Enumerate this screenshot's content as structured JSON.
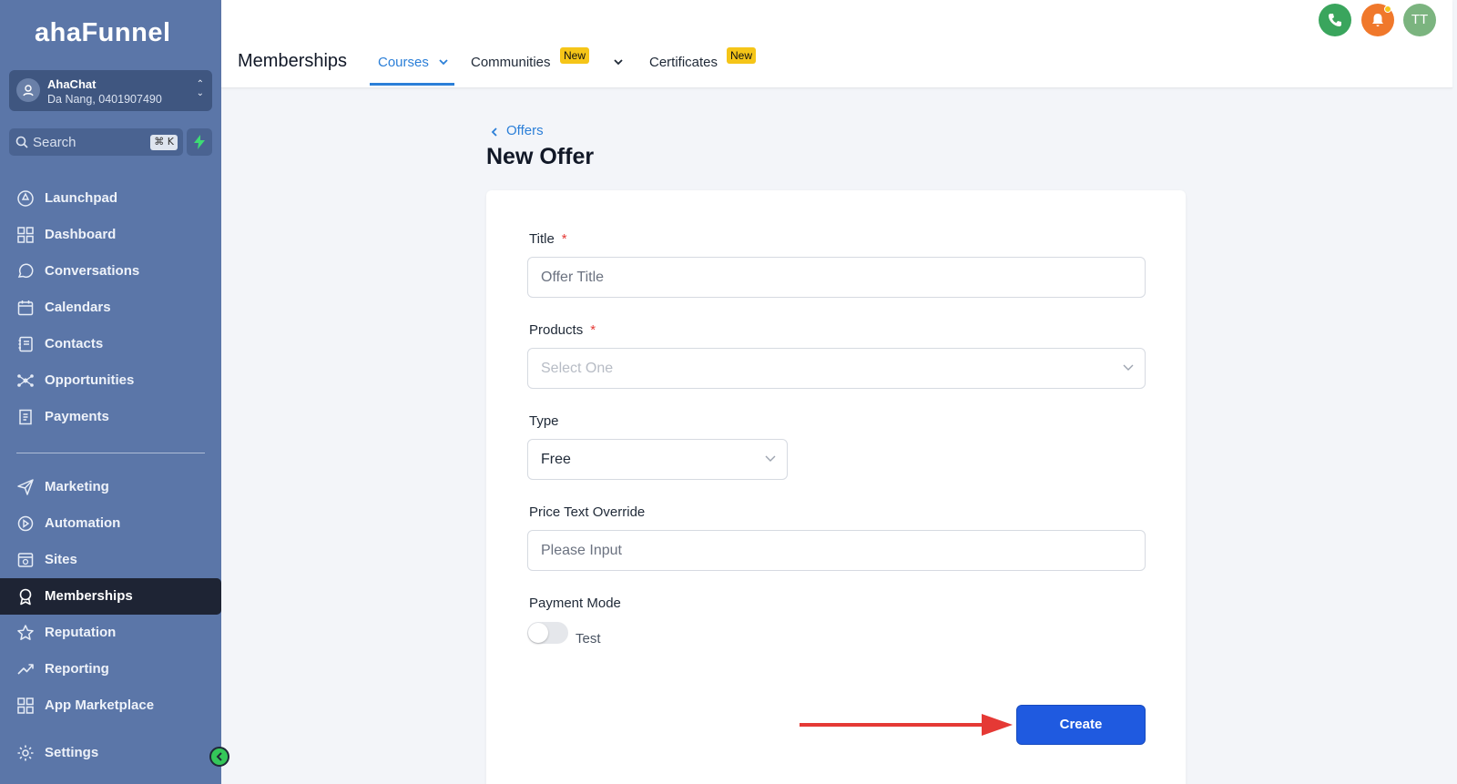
{
  "brand": {
    "logo": "ahaFunnel"
  },
  "account": {
    "name": "AhaChat",
    "location": "Da Nang, 0401907490"
  },
  "search": {
    "placeholder": "Search",
    "shortcut": "⌘ K"
  },
  "sidebar": {
    "items": [
      {
        "label": "Launchpad",
        "icon": "rocket-icon"
      },
      {
        "label": "Dashboard",
        "icon": "grid-icon"
      },
      {
        "label": "Conversations",
        "icon": "chat-icon"
      },
      {
        "label": "Calendars",
        "icon": "calendar-icon"
      },
      {
        "label": "Contacts",
        "icon": "contacts-icon"
      },
      {
        "label": "Opportunities",
        "icon": "network-icon"
      },
      {
        "label": "Payments",
        "icon": "receipt-icon"
      },
      {
        "label": "Marketing",
        "icon": "send-icon"
      },
      {
        "label": "Automation",
        "icon": "automation-icon"
      },
      {
        "label": "Sites",
        "icon": "globe-icon"
      },
      {
        "label": "Memberships",
        "icon": "award-icon",
        "active": true
      },
      {
        "label": "Reputation",
        "icon": "star-icon"
      },
      {
        "label": "Reporting",
        "icon": "trend-icon"
      },
      {
        "label": "App Marketplace",
        "icon": "apps-icon"
      },
      {
        "label": "Settings",
        "icon": "gear-icon"
      }
    ]
  },
  "header": {
    "title": "Memberships",
    "tabs": [
      {
        "label": "Courses",
        "active": true
      },
      {
        "label": "Communities",
        "badge": "New"
      },
      {
        "label": "Certificates",
        "badge": "New"
      }
    ],
    "avatar_initials": "TT"
  },
  "page": {
    "breadcrumb": "Offers",
    "heading": "New Offer"
  },
  "form": {
    "title": {
      "label": "Title",
      "placeholder": "Offer Title"
    },
    "products": {
      "label": "Products",
      "placeholder": "Select One"
    },
    "type": {
      "label": "Type",
      "value": "Free"
    },
    "price_text": {
      "label": "Price Text Override",
      "placeholder": "Please Input"
    },
    "payment_mode": {
      "label": "Payment Mode",
      "toggle_label": "Test",
      "enabled": false
    },
    "required_marker": "*",
    "submit_label": "Create"
  },
  "colors": {
    "sidebar_bg": "#5b76a8",
    "accent_blue": "#2b7fd8",
    "primary_button": "#1f5ae0",
    "badge_yellow": "#f5c518",
    "annotation_arrow": "#e53935"
  }
}
